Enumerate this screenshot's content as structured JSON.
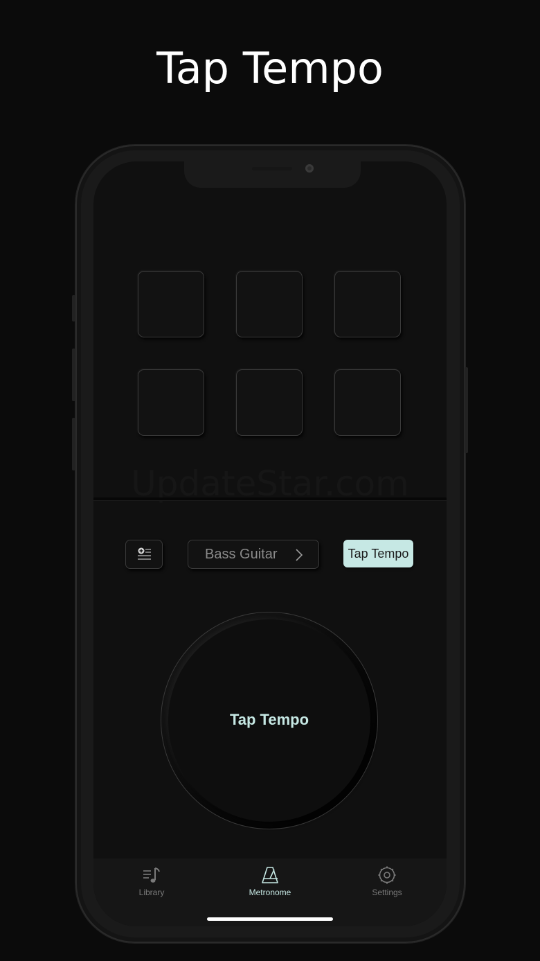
{
  "header": {
    "title": "Tap Tempo"
  },
  "watermark": "UpdateStar.com",
  "controls": {
    "preset_label": "Bass Guitar",
    "tap_mode_label": "Tap Tempo"
  },
  "dial": {
    "label": "Tap Tempo"
  },
  "tabs": [
    {
      "label": "Library",
      "icon": "music-list-icon"
    },
    {
      "label": "Metronome",
      "icon": "metronome-icon"
    },
    {
      "label": "Settings",
      "icon": "gear-icon"
    }
  ],
  "colors": {
    "accent": "#c6e8e4",
    "background": "#0b0b0b",
    "screen": "#101010"
  }
}
